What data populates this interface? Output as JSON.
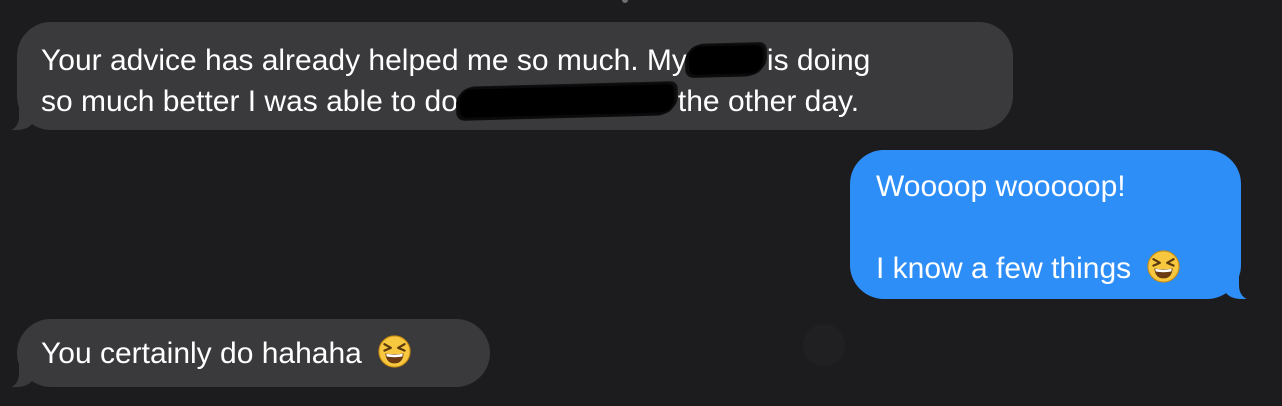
{
  "messages": [
    {
      "sender": "them",
      "lines": [
        {
          "before": "Your advice has already helped me so much. My",
          "after": "is doing"
        },
        {
          "before": "so much better I was able to do",
          "after": "the other day."
        }
      ]
    },
    {
      "sender": "me",
      "lines": [
        "Woooop wooooop!",
        "",
        "I know a few things"
      ],
      "emoji": "squinting-grin-emoji"
    },
    {
      "sender": "them",
      "text": "You certainly do hahaha",
      "emoji": "squinting-grin-emoji"
    }
  ],
  "colors": {
    "background": "#1c1c1e",
    "incoming_bubble": "#3a3a3c",
    "outgoing_bubble": "#2e8ef8",
    "text": "#ffffff",
    "redaction": "#000000"
  }
}
